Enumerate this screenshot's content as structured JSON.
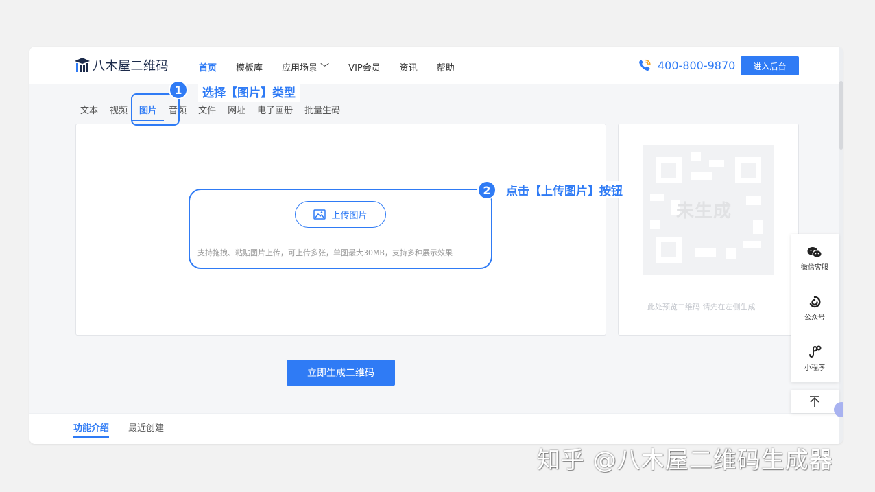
{
  "brand": {
    "name": "八木屋二维码"
  },
  "nav": {
    "items": [
      {
        "label": "首页",
        "active": true
      },
      {
        "label": "模板库",
        "active": false
      },
      {
        "label": "应用场景 ﹀",
        "active": false
      },
      {
        "label": "VIP会员",
        "active": false
      },
      {
        "label": "资讯",
        "active": false
      },
      {
        "label": "帮助",
        "active": false
      }
    ],
    "phone": "400-800-9870",
    "enter_label": "进入后台"
  },
  "tabs": [
    {
      "label": "文本",
      "active": false
    },
    {
      "label": "视频",
      "active": false
    },
    {
      "label": "图片",
      "active": true
    },
    {
      "label": "音频",
      "active": false
    },
    {
      "label": "文件",
      "active": false
    },
    {
      "label": "网址",
      "active": false
    },
    {
      "label": "电子画册",
      "active": false
    },
    {
      "label": "批量生码",
      "active": false
    }
  ],
  "upload": {
    "button_label": "上传图片",
    "hint": "支持拖拽、粘贴图片上传，可上传多张，单图最大30MB，支持多种展示效果"
  },
  "preview": {
    "status": "未生成",
    "note": "此处预览二维码 请先在左侧生成"
  },
  "generate_label": "立即生成二维码",
  "bottom_tabs": [
    {
      "label": "功能介绍",
      "active": true
    },
    {
      "label": "最近创建",
      "active": false
    }
  ],
  "side_tools": [
    {
      "label": "微信客服",
      "icon": "wechat-icon"
    },
    {
      "label": "公众号",
      "icon": "official-account-icon"
    },
    {
      "label": "小程序",
      "icon": "mini-program-icon"
    }
  ],
  "back_to_top": "⊤",
  "annotations": {
    "step1_number": "1",
    "step1_text": "选择【图片】类型",
    "step2_number": "2",
    "step2_text": "点击【上传图片】按钮"
  },
  "watermark": "知乎 @八木屋二维码生成器",
  "colors": {
    "accent": "#2f7bf5",
    "background": "#f2f2f2"
  }
}
